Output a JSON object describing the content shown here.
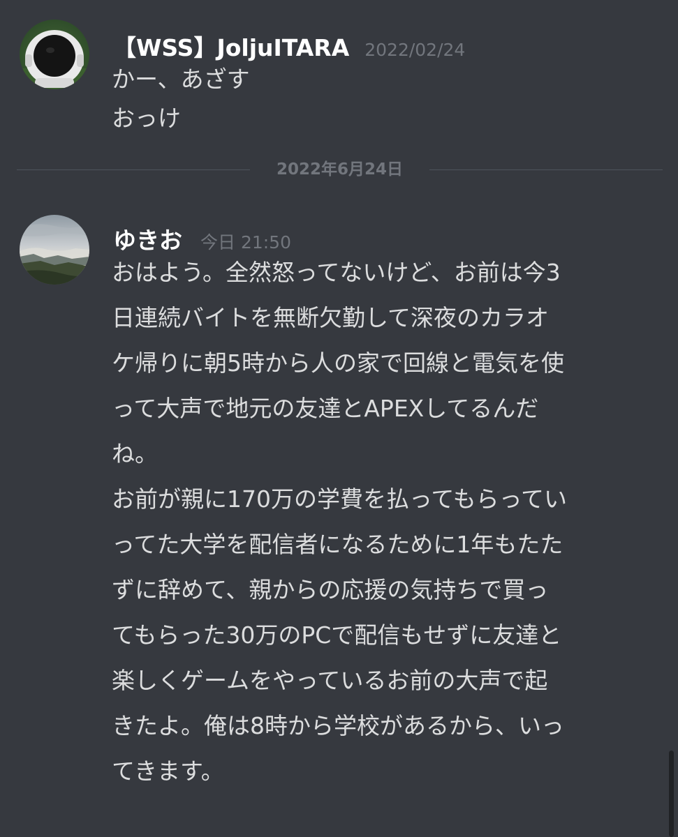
{
  "colors": {
    "background": "#36393f",
    "username": "#ffffff",
    "text": "#dcddde",
    "muted": "#72767d",
    "divider": "#4f545c"
  },
  "messages": [
    {
      "avatar_icon": "astronaut-avatar-icon",
      "username": "【WSS】JoljuITARA",
      "timestamp": "2022/02/24",
      "lines": [
        "かー、あざす",
        "おっけ"
      ]
    },
    {
      "avatar_icon": "mountain-landscape-avatar-icon",
      "username": "ゆきお",
      "timestamp": "今日 21:50",
      "lines": [
        "おはよう。全然怒ってないけど、お前は今3",
        "日連続バイトを無断欠勤して深夜のカラオ",
        "ケ帰りに朝5時から人の家で回線と電気を使",
        "って大声で地元の友達とAPEXしてるんだ",
        "ね。",
        "お前が親に170万の学費を払ってもらってい",
        "ってた大学を配信者になるために1年もたた",
        "ずに辞めて、親からの応援の気持ちで買っ",
        "てもらった30万のPCで配信もせずに友達と",
        "楽しくゲームをやっているお前の大声で起",
        "きたよ。俺は8時から学校があるから、いっ",
        "てきます。"
      ]
    }
  ],
  "date_divider": "2022年6月24日"
}
